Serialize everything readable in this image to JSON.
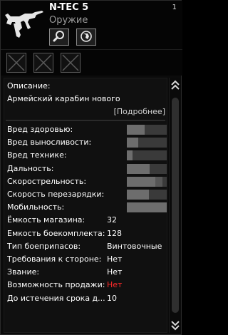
{
  "header": {
    "name": "N-TEC 5",
    "count": "1",
    "category": "Оружие",
    "weapon_icon": "assault-rifle-icon",
    "inspect_icon": "magnifier-icon",
    "globe_icon": "globe-icon"
  },
  "slots": [
    "empty-slot",
    "empty-slot",
    "empty-slot"
  ],
  "description": {
    "label": "Описание:",
    "text": "Армейский карабин нового",
    "more": "[Подробнее]"
  },
  "stat_bars": [
    {
      "label": "Вред здоровью:",
      "fill": 0.45,
      "fill2": 0.0
    },
    {
      "label": "Вред выносливости:",
      "fill": 0.28,
      "fill2": 0.0
    },
    {
      "label": "Вред технике:",
      "fill": 0.14,
      "fill2": 0.0
    },
    {
      "label": "Дальность:",
      "fill": 0.58,
      "fill2": 0.0
    },
    {
      "label": "Скорострельность:",
      "fill": 0.72,
      "fill2": 0.18
    },
    {
      "label": "Скорость перезарядки:",
      "fill": 0.55,
      "fill2": 0.0
    },
    {
      "label": "Мобильность:",
      "fill": 1.0,
      "fill2": 0.0
    }
  ],
  "stat_values": [
    {
      "label": "Ёмкость магазина:",
      "value": "32",
      "red": false
    },
    {
      "label": "Емкость боекомплекта:",
      "value": "128",
      "red": false
    },
    {
      "label": "Тип боеприпасов:",
      "value": "Винтовочные",
      "red": false
    },
    {
      "label": "Требования к стороне:",
      "value": "Нет",
      "red": false
    },
    {
      "label": "Звание:",
      "value": "Нет",
      "red": false
    },
    {
      "label": "Возможность продажи:",
      "value": "Нет",
      "red": true
    },
    {
      "label": "До истечения срока д...",
      "value": "10",
      "red": false
    }
  ],
  "colors": {
    "value_warning": "#ff2a2a",
    "bar_fill": "#6d6d6d",
    "bar_track": "#3a3a3a"
  }
}
